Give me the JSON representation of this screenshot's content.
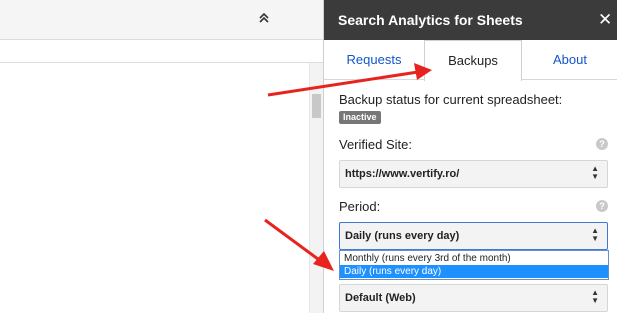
{
  "sidebar": {
    "title": "Search Analytics for Sheets",
    "close_glyph": "✕",
    "tabs": [
      {
        "label": "Requests",
        "active": false
      },
      {
        "label": "Backups",
        "active": true
      },
      {
        "label": "About",
        "active": false
      }
    ],
    "backup_status_label": "Backup status for current spreadsheet:",
    "status_badge": "Inactive",
    "verified_site_label": "Verified Site:",
    "verified_site_value": "https://www.vertify.ro/",
    "period_label": "Period:",
    "period_value": "Daily (runs every day)",
    "period_options": [
      {
        "label": "Monthly (runs every 3rd of the month)",
        "selected": false
      },
      {
        "label": "Daily (runs every day)",
        "selected": true
      }
    ],
    "next_select_value": "Default (Web)",
    "help_glyph": "?"
  },
  "spreadsheet": {
    "collapse_glyph": "⌃"
  },
  "colors": {
    "header_bg": "#3b3b3b",
    "tab_link": "#1155cc",
    "selected_option": "#1e90ff",
    "annotation_arrow": "#e8231f",
    "badge_bg": "#777777"
  },
  "icons": [
    "collapse-icon",
    "close-icon",
    "help-icon",
    "select-arrows-icon"
  ]
}
